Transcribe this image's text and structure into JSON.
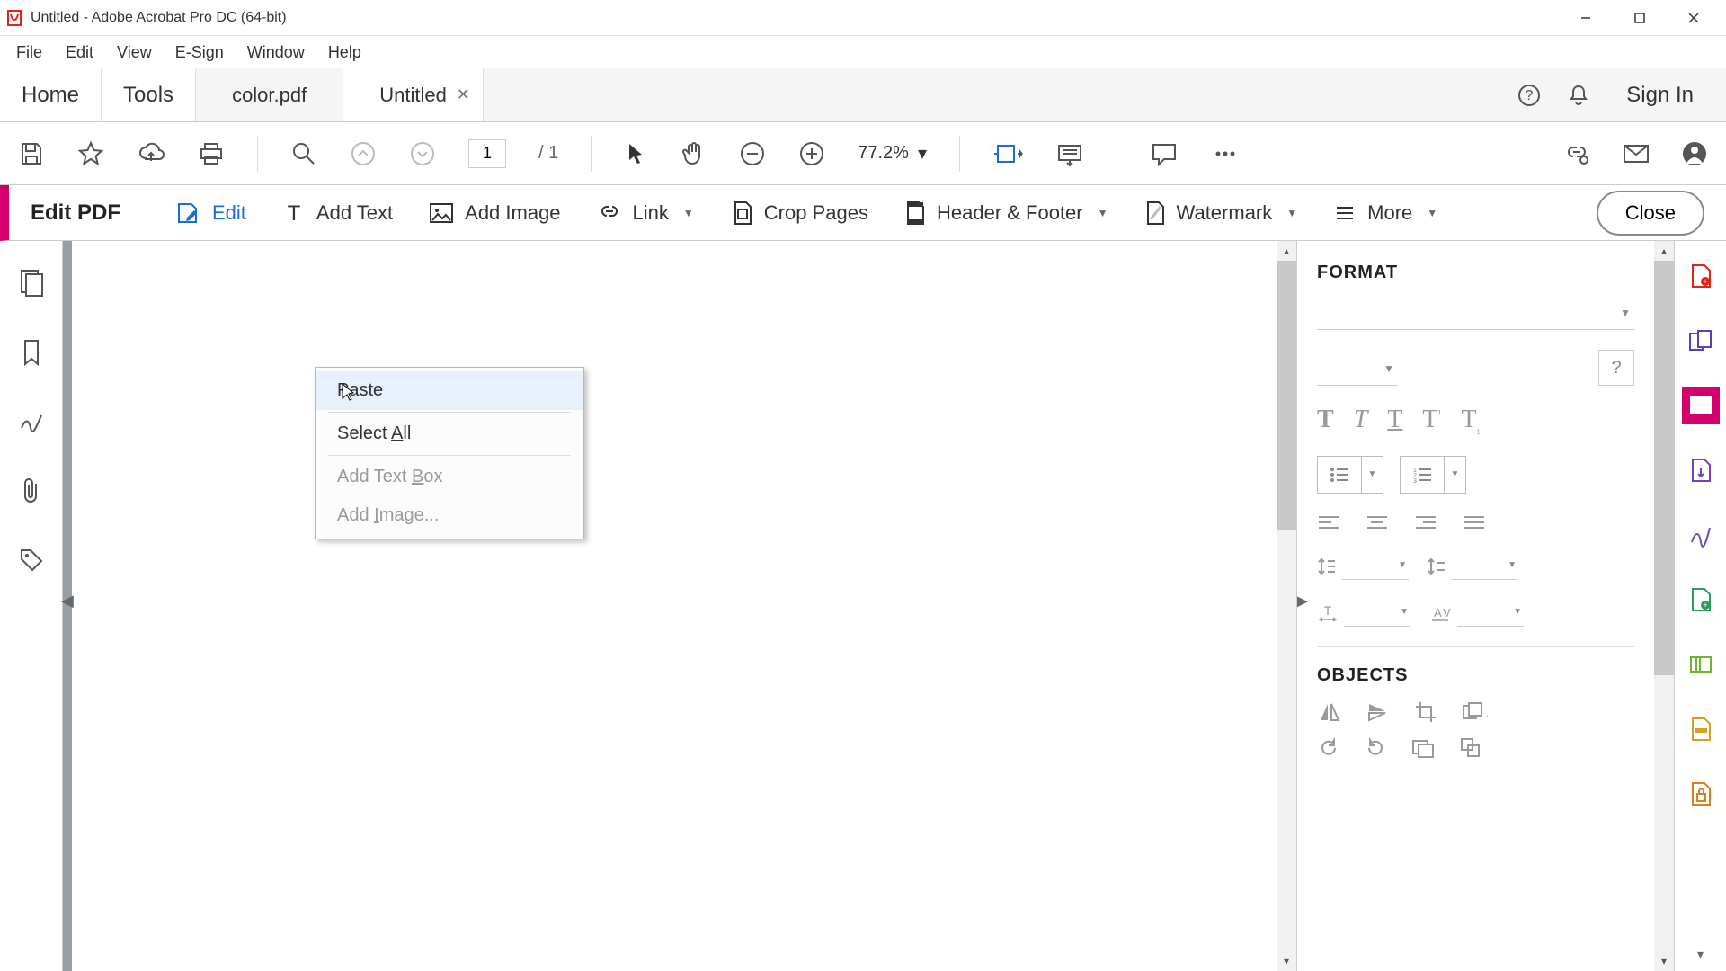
{
  "window": {
    "title": "Untitled - Adobe Acrobat Pro DC (64-bit)"
  },
  "menu": {
    "file": "File",
    "edit": "Edit",
    "view": "View",
    "esign": "E-Sign",
    "window": "Window",
    "help": "Help"
  },
  "tabs": {
    "home": "Home",
    "tools": "Tools",
    "doc1": "color.pdf",
    "doc2": "Untitled",
    "signin": "Sign In"
  },
  "toolbar": {
    "page_current": "1",
    "page_total": "/  1",
    "zoom": "77.2%"
  },
  "editbar": {
    "title": "Edit PDF",
    "edit": "Edit",
    "add_text": "Add Text",
    "add_image": "Add Image",
    "link": "Link",
    "crop": "Crop Pages",
    "header_footer": "Header & Footer",
    "watermark": "Watermark",
    "more": "More",
    "close": "Close"
  },
  "context": {
    "paste": "Paste",
    "select_all": "Select All",
    "add_text_box": "Add Text Box",
    "add_image": "Add Image..."
  },
  "format": {
    "title": "FORMAT",
    "objects": "OBJECTS"
  }
}
